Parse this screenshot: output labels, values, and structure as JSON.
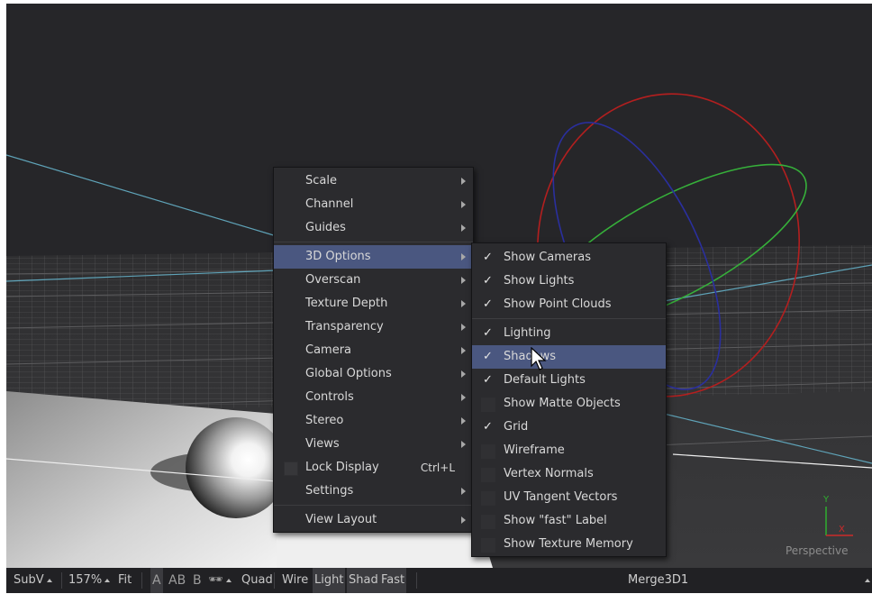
{
  "viewport": {
    "label": "Perspective",
    "axis_labels": {
      "y": "Y",
      "x": "X"
    }
  },
  "main_menu": {
    "items": [
      {
        "label": "Scale",
        "submenu": true
      },
      {
        "label": "Channel",
        "submenu": true
      },
      {
        "label": "Guides",
        "submenu": true
      },
      {
        "label": "3D Options",
        "submenu": true,
        "highlighted": true
      },
      {
        "label": "Overscan",
        "submenu": true
      },
      {
        "label": "Texture Depth",
        "submenu": true
      },
      {
        "label": "Transparency",
        "submenu": true
      },
      {
        "label": "Camera",
        "submenu": true
      },
      {
        "label": "Global Options",
        "submenu": true
      },
      {
        "label": "Controls",
        "submenu": true
      },
      {
        "label": "Stereo",
        "submenu": true
      },
      {
        "label": "Views",
        "submenu": true
      },
      {
        "label": "Lock Display",
        "shortcut": "Ctrl+L",
        "checked": false
      },
      {
        "label": "Settings",
        "submenu": true
      },
      {
        "label": "View Layout",
        "submenu": true
      }
    ]
  },
  "options_menu": {
    "check_glyph": "✓",
    "items": [
      {
        "label": "Show Cameras",
        "checked": true
      },
      {
        "label": "Show Lights",
        "checked": true
      },
      {
        "label": "Show Point Clouds",
        "checked": true
      },
      {
        "label": "Lighting",
        "checked": true
      },
      {
        "label": "Shadows",
        "checked": true,
        "highlighted": true
      },
      {
        "label": "Default Lights",
        "checked": true
      },
      {
        "label": "Show Matte Objects",
        "checked": false
      },
      {
        "label": "Grid",
        "checked": true
      },
      {
        "label": "Wireframe",
        "checked": false
      },
      {
        "label": "Vertex Normals",
        "checked": false
      },
      {
        "label": "UV Tangent Vectors",
        "checked": false
      },
      {
        "label": "Show \"fast\" Label",
        "checked": false
      },
      {
        "label": "Show Texture Memory",
        "checked": false
      }
    ]
  },
  "toolbar": {
    "subv": "SubV",
    "zoom": "157%",
    "fit": "Fit",
    "a": "A",
    "ab": "AB",
    "b": "B",
    "stereo_glyph": "🕶",
    "quad": "Quad",
    "wire": "Wire",
    "light": "Light",
    "shad": "Shad",
    "fast": "Fast",
    "node": "Merge3D1"
  },
  "colors": {
    "highlight": "#4a5780",
    "axis_y": "#2fae2f",
    "axis_x": "#cc2a2a",
    "light_ring_red": "#b31f1f",
    "light_ring_green": "#36b03a",
    "light_ring_blue": "#2a2f9e"
  }
}
